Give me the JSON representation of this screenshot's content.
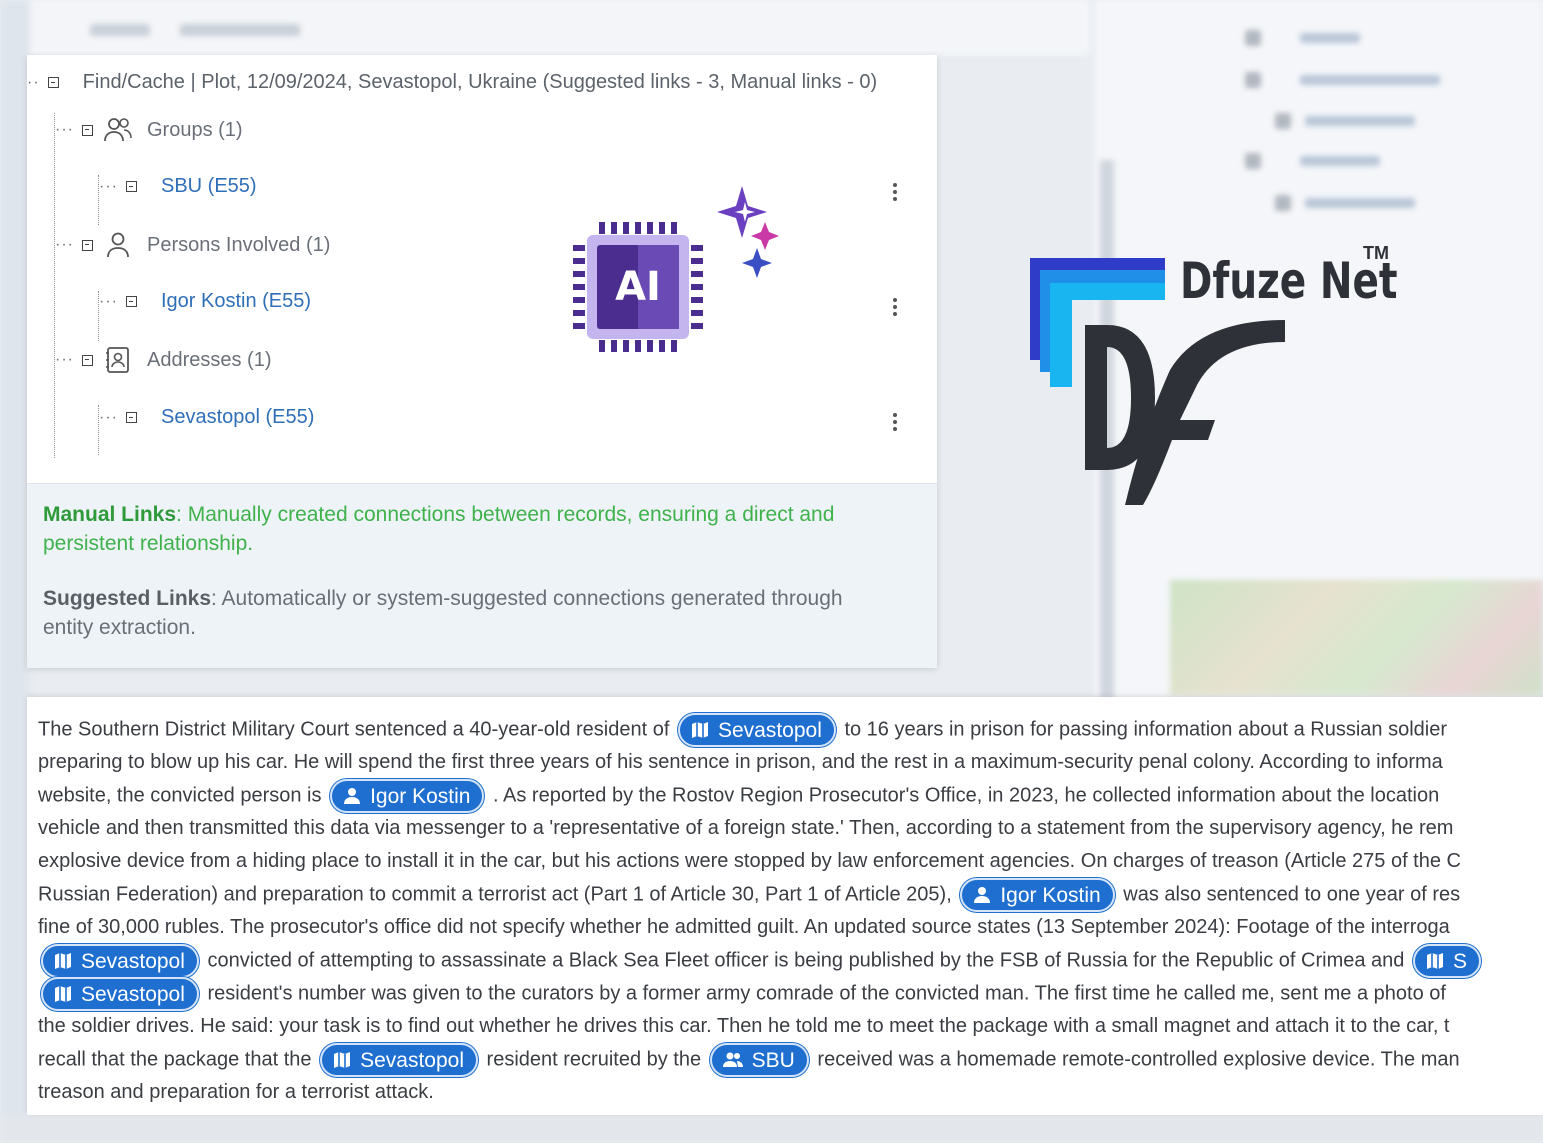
{
  "tree": {
    "header": "Find/Cache | Plot, 12/09/2024, Sevastopol, Ukraine (Suggested links - 3, Manual links - 0)",
    "groups": [
      {
        "label": "Groups (1)",
        "icon": "people-icon",
        "child": "SBU (E55)"
      },
      {
        "label": "Persons Involved (1)",
        "icon": "person-icon",
        "child": "Igor Kostin (E55)"
      },
      {
        "label": "Addresses (1)",
        "icon": "address-book-icon",
        "child": "Sevastopol (E55)"
      }
    ]
  },
  "ai_badge": {
    "label": "AI"
  },
  "legend": {
    "manual_title": "Manual Links",
    "manual_text": ": Manually created connections between records, ensuring a direct and persistent relationship.",
    "suggested_title": "Suggested Links",
    "suggested_text": ": Automatically or system-suggested connections generated through entity extraction."
  },
  "logo": {
    "name": "Dfuze Net",
    "tm": "TM",
    "mark": "Df"
  },
  "article": {
    "l1a": "The Southern District Military Court sentenced a 40-year-old resident of",
    "chip1": "Sevastopol",
    "l1b": "to 16 years in prison for passing information about a Russian soldier",
    "l2": "preparing to blow up his car. He will spend the first three years of his sentence in prison, and the rest in a maximum-security penal colony. According to informa",
    "l3a": "website, the convicted person is",
    "chip2": "Igor Kostin",
    "l3b": ". As reported by the Rostov Region Prosecutor's Office, in 2023, he collected information about the location",
    "l4": "vehicle and then transmitted this data via messenger to a 'representative of a foreign state.' Then, according to a statement from the supervisory agency, he rem",
    "l5": "explosive device from a hiding place to install it in the car, but his actions were stopped by law enforcement agencies. On charges of treason (Article 275 of the C",
    "l6a": "Russian Federation) and preparation to commit a terrorist act (Part 1 of Article 30, Part 1 of Article 205),",
    "chip3": "Igor Kostin",
    "l6b": "was also sentenced to one year of res",
    "l7": "fine of 30,000 rubles. The prosecutor's office did not specify whether he admitted guilt. An updated source states (13 September 2024): Footage of the interroga",
    "chip4": "Sevastopol",
    "l8": "convicted of attempting to assassinate a Black Sea Fleet officer is being published by the FSB of Russia for the Republic of Crimea and",
    "chip5": "S",
    "chip6": "Sevastopol",
    "l9": "resident's number was given to the curators by a former army comrade of the convicted man. The first time he called me, sent me a photo of",
    "l10": "the soldier drives. He said: your task is to find out whether he drives this car. Then he told me to meet the package with a small magnet and attach it to the car, t",
    "l11a": "recall that the package that the",
    "chip7": "Sevastopol",
    "l11b": "resident recruited by the",
    "chip8": "SBU",
    "l11c": "received was a homemade remote-controlled explosive device. The man",
    "l12": "treason and preparation for a terrorist attack."
  },
  "colors": {
    "chip": "#1f6fd0",
    "link": "#2f6fb8",
    "manual": "#3fb24b",
    "ai_dark": "#4b2d8f",
    "ai_light": "#c5b5ee"
  }
}
